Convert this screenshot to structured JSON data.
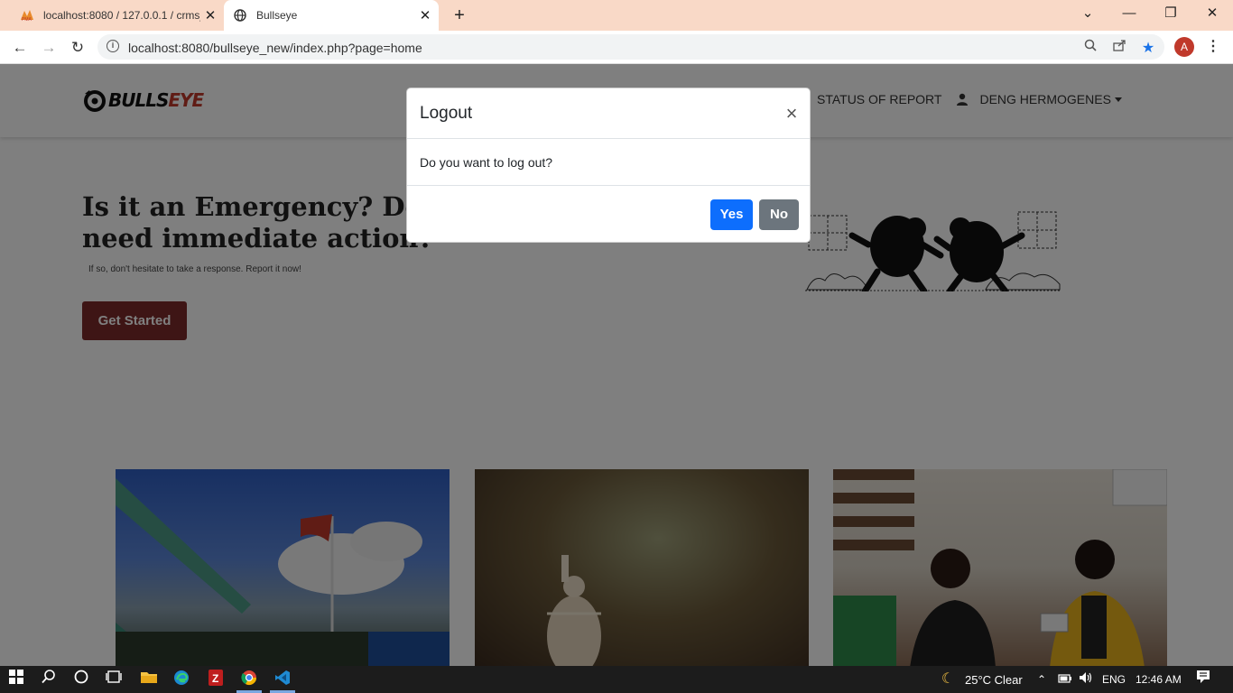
{
  "browser": {
    "tabs": [
      {
        "title": "localhost:8080 / 127.0.0.1 / crms_",
        "favicon": "phpmyadmin-icon",
        "active": false
      },
      {
        "title": "Bullseye",
        "favicon": "globe-icon",
        "active": true
      }
    ],
    "new_tab": "+",
    "url": "localhost:8080/bullseye_new/index.php?page=home",
    "profile_initial": "A",
    "window_controls": {
      "dropdown": "⌄",
      "minimize": "—",
      "restore": "❐",
      "close": "✕"
    }
  },
  "site": {
    "logo_text_1": "BULLS",
    "logo_text_2": "EYE",
    "nav": {
      "status_report": "STATUS OF REPORT",
      "user_name": "DENG HERMOGENES"
    },
    "hero": {
      "title": "Is it an Emergency? Does it need immediate action?",
      "subtitle": "If so, don't hesitate to take a response. Report it now!",
      "cta": "Get Started"
    }
  },
  "modal": {
    "title": "Logout",
    "close_glyph": "×",
    "message": "Do you want to log out?",
    "yes": "Yes",
    "no": "No"
  },
  "taskbar": {
    "weather": "25°C  Clear",
    "language": "ENG",
    "time": "12:46 AM"
  },
  "colors": {
    "tab_strip": "#f9d9c7",
    "cta": "#7d2a2a",
    "yes_button": "#0d6efd",
    "no_button": "#6c757d",
    "logo_accent": "#c0392b"
  }
}
